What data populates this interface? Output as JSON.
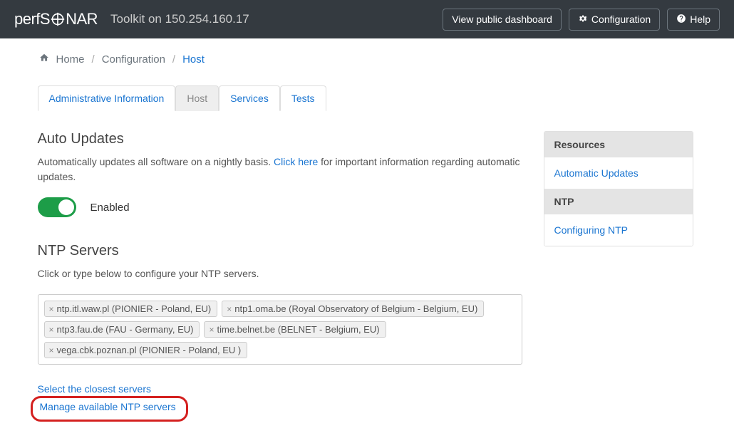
{
  "navbar": {
    "brand_prefix": "perfS",
    "brand_suffix": "NAR",
    "title": "Toolkit on 150.254.160.17",
    "buttons": {
      "dashboard": "View public dashboard",
      "config": "Configuration",
      "help": "Help"
    }
  },
  "breadcrumb": {
    "home": "Home",
    "config": "Configuration",
    "host": "Host"
  },
  "tabs": {
    "admin": "Administrative Information",
    "host": "Host",
    "services": "Services",
    "tests": "Tests"
  },
  "auto_updates": {
    "heading": "Auto Updates",
    "desc_prefix": "Automatically updates all software on a nightly basis. ",
    "desc_link": "Click here",
    "desc_suffix": " for important information regarding automatic updates.",
    "toggle_label": "Enabled"
  },
  "ntp": {
    "heading": "NTP Servers",
    "desc": "Click or type below to configure your NTP servers.",
    "servers": [
      "ntp.itl.waw.pl (PIONIER - Poland, EU)",
      "ntp1.oma.be (Royal Observatory of Belgium - Belgium, EU)",
      "ntp3.fau.de (FAU - Germany, EU)",
      "time.belnet.be (BELNET - Belgium, EU)",
      "vega.cbk.poznan.pl (PIONIER - Poland, EU )"
    ],
    "select_closest": "Select the closest servers",
    "manage_link": "Manage available NTP servers"
  },
  "sidebar": {
    "resources_heading": "Resources",
    "auto_updates_link": "Automatic Updates",
    "ntp_heading": "NTP",
    "ntp_link": "Configuring NTP"
  }
}
